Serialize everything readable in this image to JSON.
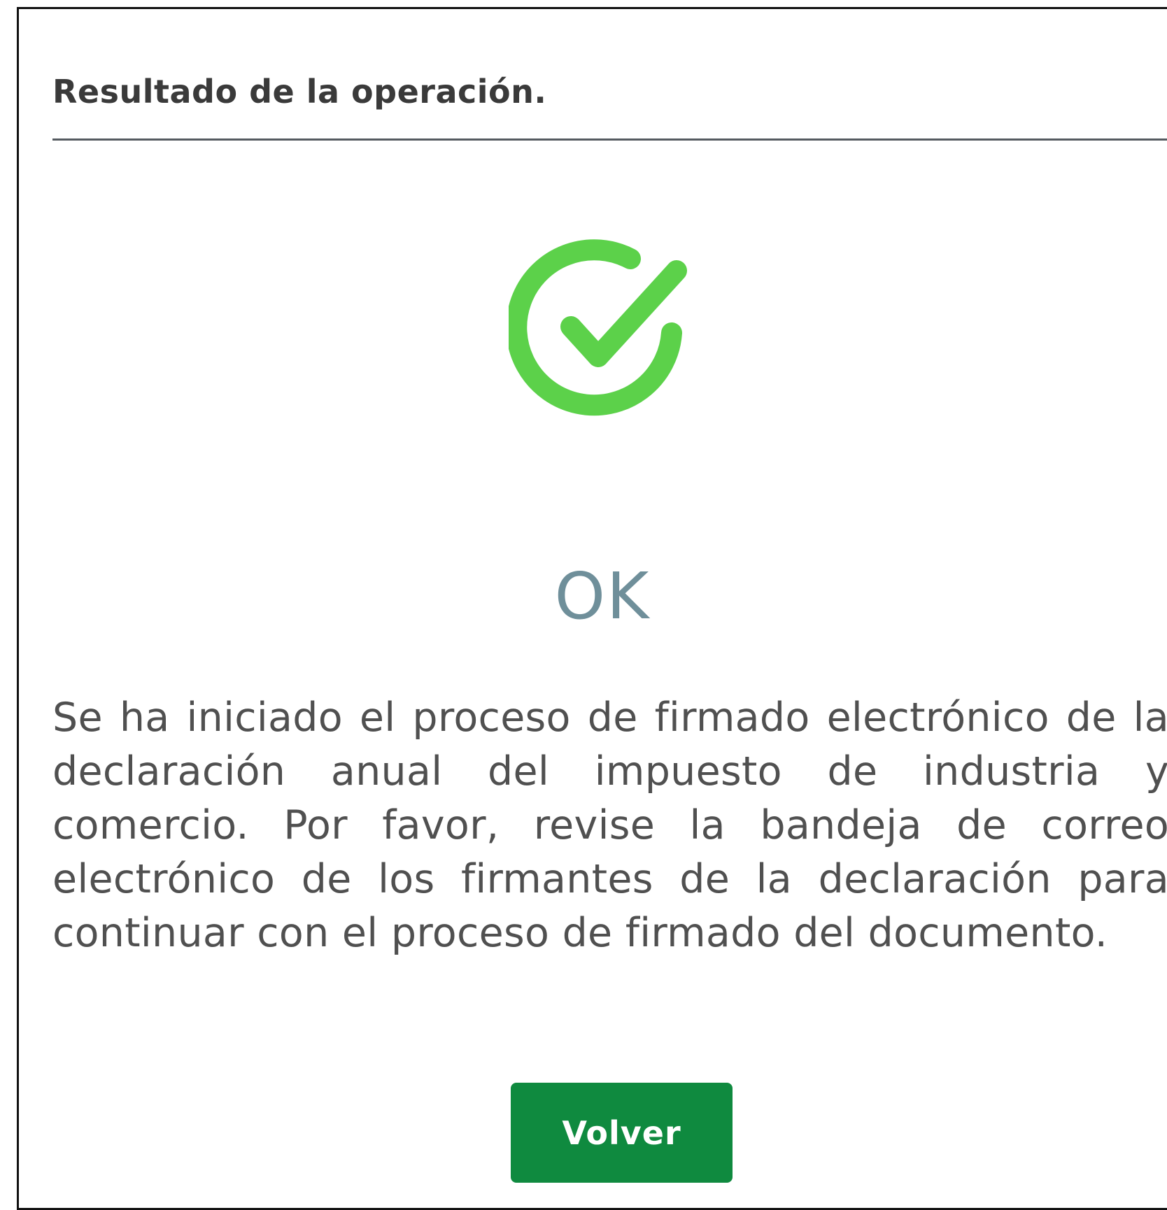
{
  "dialog": {
    "title": "Resultado de la operación.",
    "status_icon": "check-circle-icon",
    "status_text": "OK",
    "message": "Se ha iniciado el proceso de firmado electrónico de la declaración anual del impuesto de industria y comercio. Por favor, revise la bandeja de correo electrónico de los firmantes de la declaración para continuar con el proceso de firmado del documento.",
    "back_button_label": "Volver"
  },
  "colors": {
    "success_icon": "#5cd14a",
    "status_text": "#6f8f9a",
    "button": "#0f8a3f",
    "divider": "#555a60"
  }
}
